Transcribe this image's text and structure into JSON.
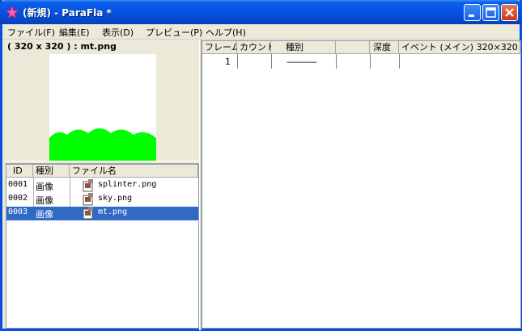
{
  "window": {
    "title": "(新規) - ParaFla *",
    "buttons": [
      "minimize",
      "maximize",
      "close"
    ]
  },
  "menu": [
    {
      "label": "ファイル(F)"
    },
    {
      "label": "編集(E)"
    },
    {
      "label": "表示(D)"
    },
    {
      "label": "プレビュー(P)"
    },
    {
      "label": "ヘルプ(H)"
    }
  ],
  "preview": {
    "label": "( 320 x 320 ) : mt.png",
    "colors": {
      "hill": "#00ff00",
      "canvas": "#ffffff"
    }
  },
  "asset_list": {
    "headers": [
      "ID",
      "種別",
      "ファイル名"
    ],
    "rows": [
      {
        "id": "0001",
        "type": "画像",
        "file": "splinter.png",
        "selected": false
      },
      {
        "id": "0002",
        "type": "画像",
        "file": "sky.png",
        "selected": false
      },
      {
        "id": "0003",
        "type": "画像",
        "file": "mt.png",
        "selected": true
      }
    ]
  },
  "event_table": {
    "headers": [
      "フレーム",
      "カウント",
      "種別",
      "",
      "深度",
      "イベント (メイン) 320×320"
    ],
    "rows": [
      {
        "frame": "1",
        "count": "",
        "type": "————",
        "extra": "",
        "depth": "",
        "event": ""
      }
    ]
  },
  "colors": {
    "selection": "#316ac5",
    "titlebar": "#0553e1"
  }
}
